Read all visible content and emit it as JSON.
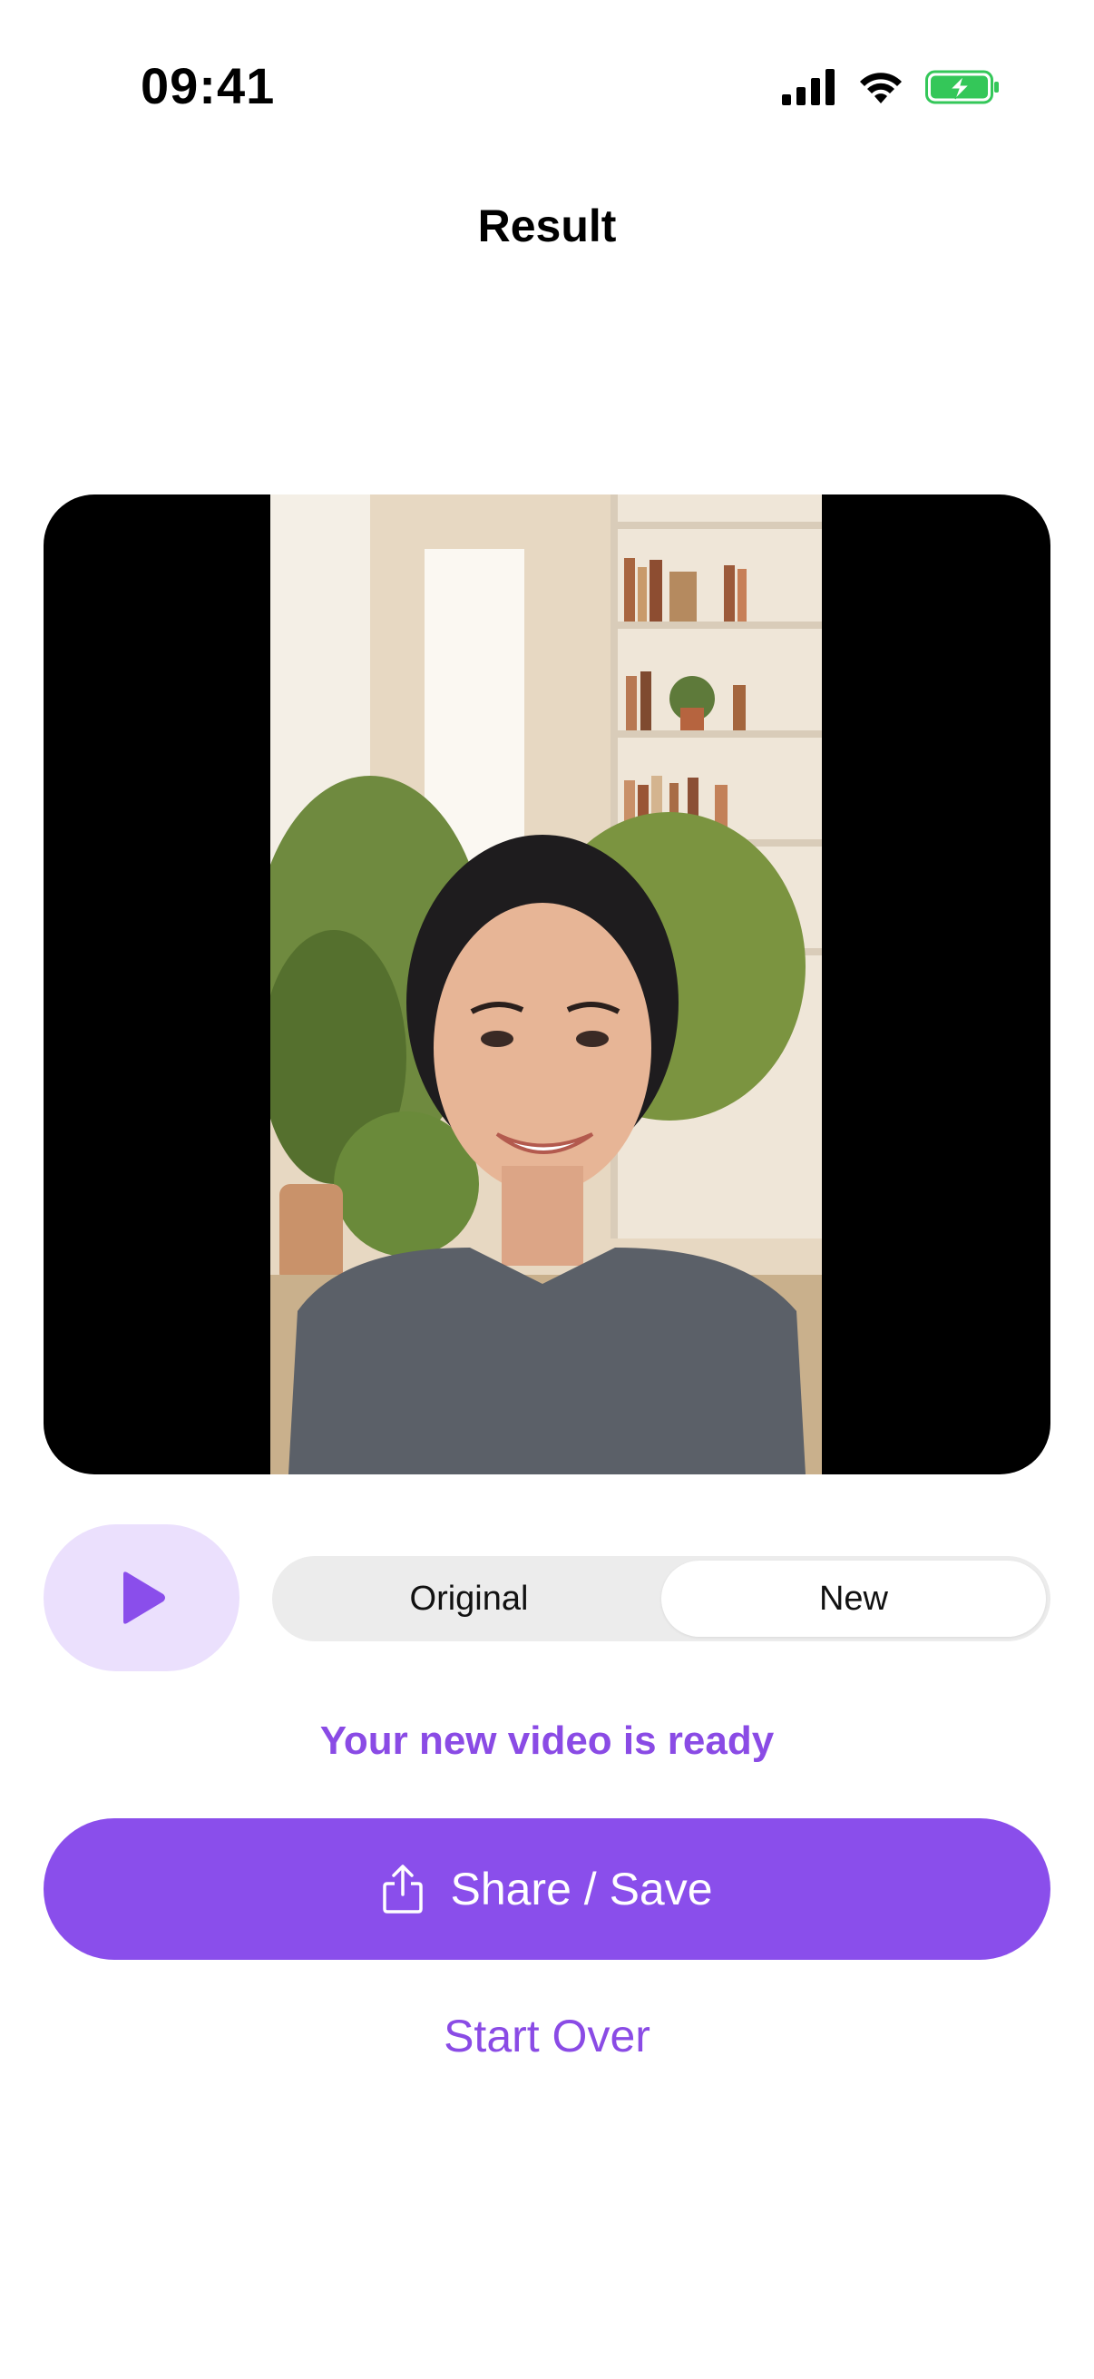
{
  "status_bar": {
    "time": "09:41"
  },
  "nav": {
    "title": "Result"
  },
  "video": {
    "description_icon": "video-preview"
  },
  "controls": {
    "segments": [
      {
        "label": "Original",
        "selected": false
      },
      {
        "label": "New",
        "selected": true
      }
    ]
  },
  "status": {
    "message": "Your new video is ready"
  },
  "actions": {
    "share_label": "Share / Save",
    "start_over_label": "Start Over"
  },
  "colors": {
    "accent": "#8a4eeb",
    "accent_text": "#8a4be5",
    "play_bg": "#ebe0fd",
    "battery_green": "#34c759"
  }
}
